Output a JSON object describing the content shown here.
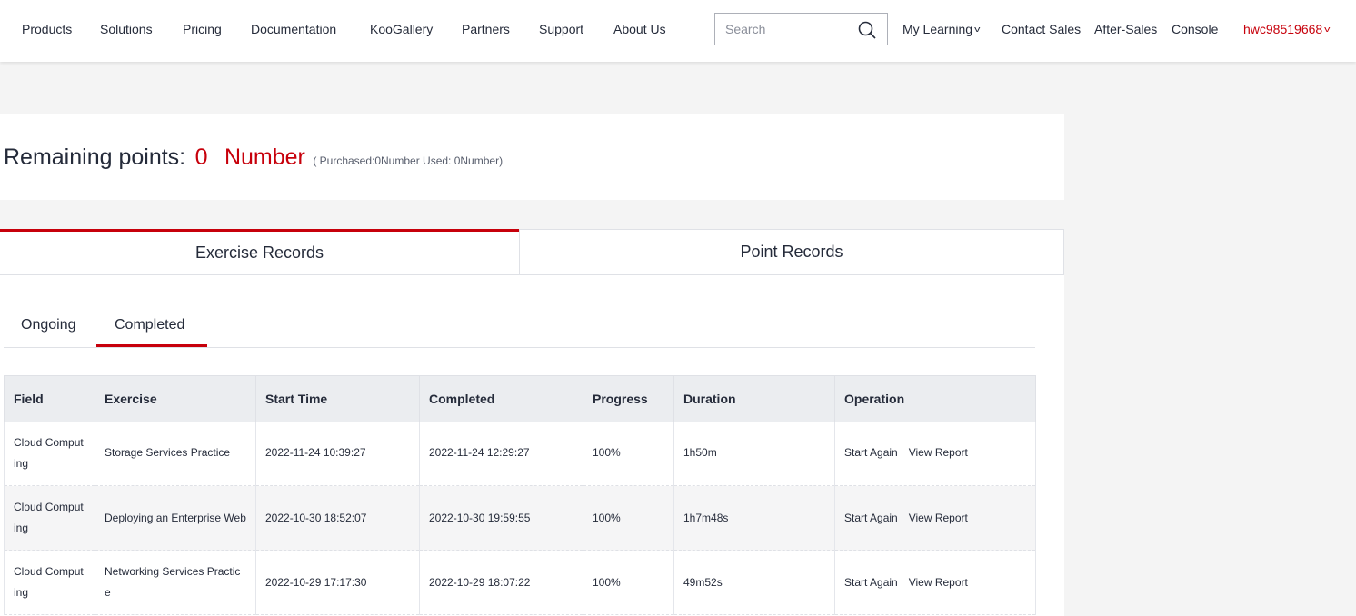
{
  "nav": {
    "items": [
      "Products",
      "Solutions",
      "Pricing",
      "Documentation",
      "KooGallery",
      "Partners",
      "Support",
      "About Us"
    ],
    "search_placeholder": "Search",
    "my_learning": "My Learning",
    "contact_sales": "Contact Sales",
    "after_sales": "After-Sales",
    "console": "Console",
    "username": "hwc98519668"
  },
  "points": {
    "label": "Remaining points:",
    "value": "0",
    "unit": "Number",
    "detail": "( Purchased:0Number   Used: 0Number)"
  },
  "main_tabs": {
    "exercise": "Exercise Records",
    "points": "Point Records"
  },
  "sub_tabs": {
    "ongoing": "Ongoing",
    "completed": "Completed"
  },
  "table": {
    "headers": [
      "Field",
      "Exercise",
      "Start Time",
      "Completed",
      "Progress",
      "Duration",
      "Operation"
    ],
    "rows": [
      {
        "field": "Cloud Computing",
        "exercise": "Storage Services Practice",
        "start": "2022-11-24 10:39:27",
        "completed": "2022-11-24 12:29:27",
        "progress": "100%",
        "duration": "1h50m",
        "op1": "Start Again",
        "op2": "View Report"
      },
      {
        "field": "Cloud Computing",
        "exercise": "Deploying an Enterprise Web",
        "start": "2022-10-30 18:52:07",
        "completed": "2022-10-30 19:59:55",
        "progress": "100%",
        "duration": "1h7m48s",
        "op1": "Start Again",
        "op2": "View Report"
      },
      {
        "field": "Cloud Computing",
        "exercise": "Networking Services Practice",
        "start": "2022-10-29 17:17:30",
        "completed": "2022-10-29 18:07:22",
        "progress": "100%",
        "duration": "49m52s",
        "op1": "Start Again",
        "op2": "View Report"
      }
    ]
  },
  "colors": {
    "accent": "#c7000b",
    "text": "#252b3a",
    "header_bg": "#ebedf0"
  }
}
